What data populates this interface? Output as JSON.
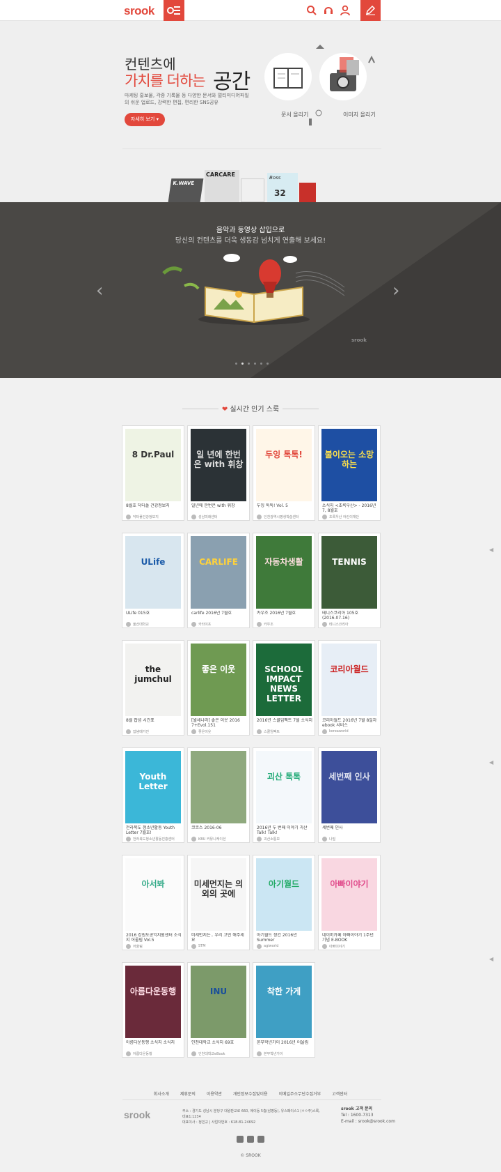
{
  "header": {
    "logo": "srook",
    "icons": [
      "search-icon",
      "headset-icon",
      "user-icon",
      "pencil-icon"
    ],
    "accent": "#e2483c"
  },
  "hero": {
    "line1": "컨텐츠에",
    "line2_red": "가치를 더하는",
    "line2_big": "공간",
    "desc": "마케팅 홍보물, 각종 기록물 등 다양한 문서와 멀티미디어파일의 쉬운 업로드, 강력한 편집, 편리한 SNS공유",
    "button": "자세히 보기",
    "feature1": "문서 올리기",
    "feature2": "이미지 올리기"
  },
  "slider": {
    "title": "음악과 동영상 삽입으로",
    "subtitle": "당신의 컨텐츠를 더욱 생동감 넘치게 연출해 보세요!",
    "mark": "srook",
    "dots": 6,
    "active_dot": 1,
    "book_labels": [
      "K.WAVE",
      "CARCARE",
      "Boss",
      "32"
    ]
  },
  "section": {
    "title": "실시간 인기 스룩"
  },
  "cards": [
    {
      "title": "8월호 닥터폴 건강정보지",
      "user": "닥터폴건강정보지",
      "cover": "8 Dr.Paul",
      "bg": "#eef3e4",
      "fg": "#333"
    },
    {
      "title": "일년에 한번은 with 휘창",
      "user": "성남미래센터",
      "cover": "일 년에 한번은 with 휘창",
      "bg": "#2b3236",
      "fg": "#ddd"
    },
    {
      "title": "두잉 톡톡! Vol. 5",
      "user": "인천광역시평생학습센터",
      "cover": "두잉 톡톡!",
      "bg": "#fff6e8",
      "fg": "#e2483c"
    },
    {
      "title": "소식지 <초록우산> - 2016년 7, 8월호",
      "user": "초록우산 어린이재단",
      "cover": "불이오는 소망하는",
      "bg": "#1e4fa3",
      "fg": "#ffe14a"
    },
    {
      "title": "ULife 015호",
      "user": "울산대학교",
      "cover": "ULife",
      "bg": "#d8e6ef",
      "fg": "#1a5aa8"
    },
    {
      "title": "carlife 2016년 7월호",
      "user": "카라이프",
      "cover": "CARLIFE",
      "bg": "#8aa0b0",
      "fg": "#ffd23a"
    },
    {
      "title": "카우조 2016년 7월호",
      "user": "카우조",
      "cover": "자동차생활",
      "bg": "#3f7a3a",
      "fg": "#ffe0e0"
    },
    {
      "title": "테니스코리아 105호(2016.07.16)",
      "user": "테니스코리아",
      "cover": "TENNIS",
      "bg": "#3c5b38",
      "fg": "#fff"
    },
    {
      "title": "8월 잡념 시간표",
      "user": "잡념매거진",
      "cover": "the jumchul",
      "bg": "#f2f2f0",
      "fg": "#222"
    },
    {
      "title": "[월세나라] 좋은 이웃 2016 7+Evol.151",
      "user": "좋은이웃",
      "cover": "좋은 이웃",
      "bg": "#6f9a52",
      "fg": "#fff"
    },
    {
      "title": "2016년 스쿨임팩트 7월 소식지",
      "user": "스쿨임팩트",
      "cover": "SCHOOL IMPACT NEWS LETTER",
      "bg": "#1c6b3a",
      "fg": "#fff"
    },
    {
      "title": "코리아월드 2016년 7월 8일자 ebook 서비스",
      "user": "koreaworld",
      "cover": "코리아월드",
      "bg": "#e7eef6",
      "fg": "#c22"
    },
    {
      "title": "전라북도 청소년활동 Youth Letter 7월호!",
      "user": "전라북도청소년활동진흥센터",
      "cover": "Youth Letter",
      "bg": "#3bb7d8",
      "fg": "#fff"
    },
    {
      "title": "코코스 2016-06",
      "user": "KBU 커뮤니케이션",
      "cover": "",
      "bg": "#8fa97e",
      "fg": "#fff"
    },
    {
      "title": "2016년 두 번째 이야기 괴산 Talk! Talk!",
      "user": "괴산소통보",
      "cover": "괴산 톡톡",
      "bg": "#f4f8fb",
      "fg": "#2a7"
    },
    {
      "title": "세번째 인사",
      "user": "나빌",
      "cover": "세번째 인사",
      "bg": "#3d4f9a",
      "fg": "#dfe2f0"
    },
    {
      "title": "2016 강원도공익지원센터 소식지 어울림 Vol.5",
      "user": "어울림",
      "cover": "아서봐",
      "bg": "#fbfbfb",
      "fg": "#3a8"
    },
    {
      "title": "미세먼지는.. 우리 고민 해주세요",
      "user": "STM",
      "cover": "미세먼지는 의외의 곳에",
      "bg": "#f6f6f6",
      "fg": "#333"
    },
    {
      "title": "아기월드 창간 2016년 Summer",
      "user": "agiworld",
      "cover": "아기월드",
      "bg": "#cbe6f3",
      "fg": "#2a6"
    },
    {
      "title": "네이버카페 아빠이야기 1주년 기념 E-BOOK",
      "user": "아빠이야기",
      "cover": "아빠이야기",
      "bg": "#f9d7e1",
      "fg": "#e04a8a"
    },
    {
      "title": "아름다운동행 소식지 소식지",
      "user": "아름다운동행",
      "cover": "아름다운동행",
      "bg": "#6a2a3a",
      "fg": "#ffdde6"
    },
    {
      "title": "인천대학교 소식지 69호",
      "user": "인천대학교eBook",
      "cover": "INU",
      "bg": "#7c9a6a",
      "fg": "#1a4f9a"
    },
    {
      "title": "본부학년가이 2016년 어울림",
      "user": "본부학년가이",
      "cover": "착한 가게",
      "bg": "#3f9fc4",
      "fg": "#fff"
    }
  ],
  "footer": {
    "nav": [
      "회사소개",
      "제휴문의",
      "이용약관",
      "개인정보수집및이용",
      "이메일주소무단수집거부",
      "고객센터"
    ],
    "logo": "srook",
    "address": "주소 : 경기도 성남시 분당구 대왕판교로 660, 에이동 5층(삼평동), 유스페이스1 (ㅇㅇ주)스룩, 대표1:1234",
    "ceo": "대표이사 : 정민규 | 사업자번호 : 618-81-24692",
    "cs_title": "srook 고객 문의",
    "cs_tel": "Tel : 1600-7313",
    "cs_mail": "E-mail : srook@srook.com",
    "social": [
      "facebook-icon",
      "twitter-icon",
      "blog-icon"
    ],
    "copyright": "© SROOK"
  }
}
